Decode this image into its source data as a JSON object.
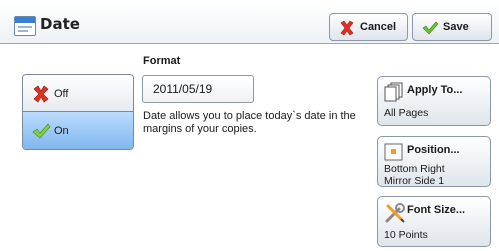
{
  "window": {
    "title": "Date"
  },
  "toolbar": {
    "cancel_label": "Cancel",
    "save_label": "Save"
  },
  "format": {
    "label": "Format",
    "value": "2011/05/19",
    "description": "Date allows you to place today`s date in the margins of your copies."
  },
  "toggle": {
    "off_label": "Off",
    "on_label": "On",
    "selected": "On"
  },
  "side_buttons": {
    "apply_to": {
      "title": "Apply To...",
      "value": "All Pages"
    },
    "position": {
      "title": "Position...",
      "value_line1": "Bottom Right",
      "value_line2": "Mirror Side 1"
    },
    "font_size": {
      "title": "Font Size...",
      "value": "10 Points"
    }
  },
  "colors": {
    "selected_bg": "#8fc0f2",
    "accent_orange": "#f0a020",
    "cancel_red": "#e03020",
    "check_green": "#4caf20"
  },
  "icons": [
    "calendar-icon",
    "cancel-x-icon",
    "save-check-icon",
    "off-x-icon",
    "on-check-icon",
    "pages-icon",
    "position-icon",
    "wrench-pencil-icon"
  ]
}
